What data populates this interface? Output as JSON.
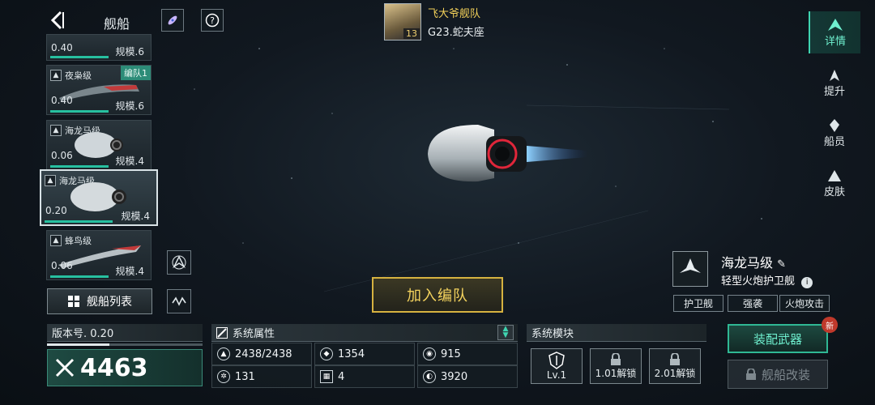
{
  "header": {
    "title": "舰船",
    "player_name": "飞大爷舰队",
    "player_level": "13",
    "player_location": "G23.蛇夫座"
  },
  "ships": [
    {
      "version": "0.40",
      "scale": "规模.6",
      "name": "",
      "team": ""
    },
    {
      "version": "0.40",
      "scale": "规模.6",
      "name": "夜枭级",
      "team": "编队1"
    },
    {
      "version": "0.06",
      "scale": "规模.4",
      "name": "海龙马级",
      "team": ""
    },
    {
      "version": "0.20",
      "scale": "规模.4",
      "name": "海龙马级",
      "team": ""
    },
    {
      "version": "0.06",
      "scale": "规模.4",
      "name": "蜂鸟级",
      "team": ""
    }
  ],
  "ship_list_label": "舰船列表",
  "right_tabs": [
    {
      "label": "详情",
      "icon": "details-icon"
    },
    {
      "label": "提升",
      "icon": "upgrade-icon"
    },
    {
      "label": "船员",
      "icon": "crew-icon"
    },
    {
      "label": "皮肤",
      "icon": "skin-icon"
    }
  ],
  "join_label": "加入编队",
  "ship_info": {
    "name": "海龙马级",
    "type": "轻型火炮护卫舰",
    "tags": [
      "护卫舰",
      "强袭",
      "火炮攻击"
    ]
  },
  "version_panel": {
    "label": "版本号. 0.20",
    "power": "4463"
  },
  "stats_panel": {
    "title": "系统属性",
    "stats": [
      {
        "icon": "armor-icon",
        "value": "2438/2438"
      },
      {
        "icon": "shield-stat-icon",
        "value": "1354"
      },
      {
        "icon": "speed-icon",
        "value": "915"
      },
      {
        "icon": "target-icon",
        "value": "131"
      },
      {
        "icon": "grid-icon",
        "value": "4"
      },
      {
        "icon": "radar-icon",
        "value": "3920"
      }
    ]
  },
  "modules_panel": {
    "title": "系统模块",
    "modules": [
      {
        "label": "Lv.1",
        "locked": false
      },
      {
        "label": "1.01解锁",
        "locked": true
      },
      {
        "label": "2.01解锁",
        "locked": true
      }
    ]
  },
  "equip_label": "装配武器",
  "new_badge": "新",
  "modify_label": "舰船改装",
  "colors": {
    "accent": "#3fd4b0",
    "gold": "#f4d35e",
    "power_bar": "#27c0a0"
  }
}
